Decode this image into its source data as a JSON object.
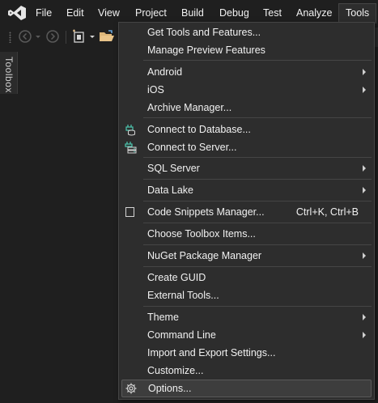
{
  "menubar": {
    "items": [
      "File",
      "Edit",
      "View",
      "Project",
      "Build",
      "Debug",
      "Test",
      "Analyze",
      "Tools"
    ]
  },
  "toolbox": {
    "label": "Toolbox"
  },
  "tools_menu": {
    "items": [
      {
        "label": "Get Tools and Features..."
      },
      {
        "label": "Manage Preview Features"
      },
      {
        "label": "Android",
        "submenu": true
      },
      {
        "label": "iOS",
        "submenu": true
      },
      {
        "label": "Archive Manager..."
      },
      {
        "label": "Connect to Database...",
        "icon": "database-connect-icon"
      },
      {
        "label": "Connect to Server...",
        "icon": "server-connect-icon"
      },
      {
        "label": "SQL Server",
        "submenu": true
      },
      {
        "label": "Data Lake",
        "submenu": true
      },
      {
        "label": "Code Snippets Manager...",
        "shortcut": "Ctrl+K, Ctrl+B",
        "icon": "checkbox-icon"
      },
      {
        "label": "Choose Toolbox Items..."
      },
      {
        "label": "NuGet Package Manager",
        "submenu": true
      },
      {
        "label": "Create GUID"
      },
      {
        "label": "External Tools..."
      },
      {
        "label": "Theme",
        "submenu": true
      },
      {
        "label": "Command Line",
        "submenu": true
      },
      {
        "label": "Import and Export Settings..."
      },
      {
        "label": "Customize..."
      },
      {
        "label": "Options...",
        "icon": "gear-icon",
        "highlighted": true
      }
    ]
  },
  "colors": {
    "background": "#1f1f1f",
    "menu_background": "#2d2d2d",
    "menu_border": "#454545",
    "vs_purple": "#b180d7",
    "icon_teal": "#4ec9b0"
  }
}
